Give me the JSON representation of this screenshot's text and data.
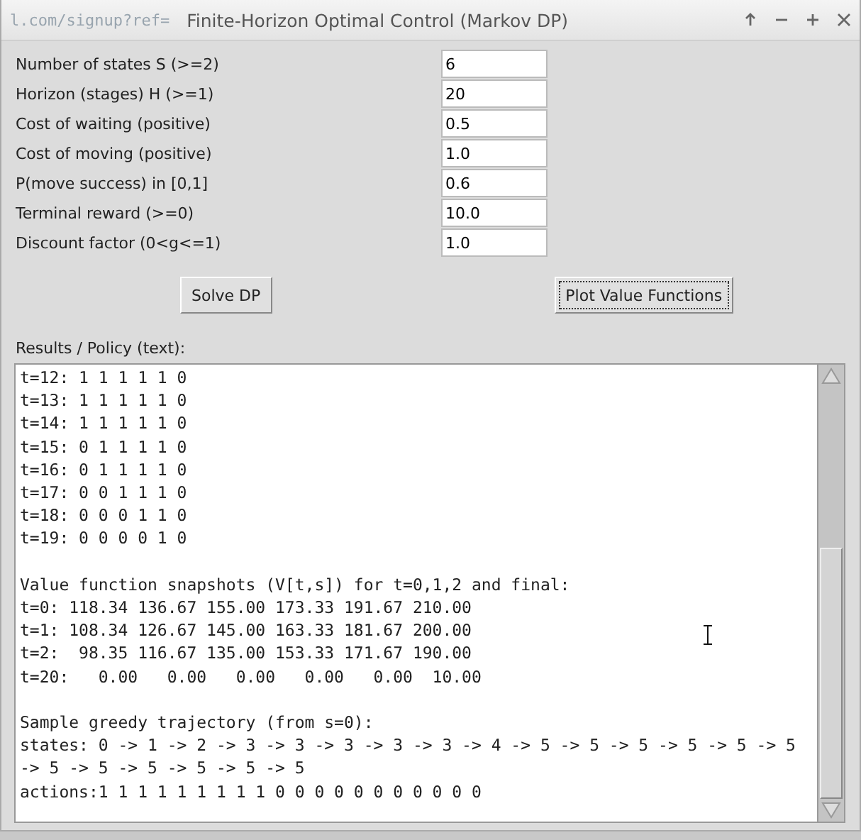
{
  "window": {
    "title": "Finite-Horizon Optimal Control (Markov DP)",
    "background_text": "l.com/signup?ref="
  },
  "fields": [
    {
      "label": "Number of states S (>=2)",
      "value": "6"
    },
    {
      "label": "Horizon (stages) H (>=1)",
      "value": "20"
    },
    {
      "label": "Cost of waiting (positive)",
      "value": "0.5"
    },
    {
      "label": "Cost of moving (positive)",
      "value": "1.0"
    },
    {
      "label": "P(move success) in [0,1]",
      "value": "0.6"
    },
    {
      "label": "Terminal reward (>=0)",
      "value": "10.0"
    },
    {
      "label": "Discount factor (0<g<=1)",
      "value": "1.0"
    }
  ],
  "buttons": [
    {
      "label": "Solve DP",
      "focused": false
    },
    {
      "label": "Plot Value Functions",
      "focused": true
    }
  ],
  "results": {
    "label": "Results / Policy (text):",
    "sections": [
      [
        "t=12: 1 1 1 1 1 0",
        "t=13: 1 1 1 1 1 0",
        "t=14: 1 1 1 1 1 0",
        "t=15: 0 1 1 1 1 0",
        "t=16: 0 1 1 1 1 0",
        "t=17: 0 0 1 1 1 0",
        "t=18: 0 0 0 1 1 0",
        "t=19: 0 0 0 0 1 0"
      ],
      [
        "Value function snapshots (V[t,s]) for t=0,1,2 and final:",
        "t=0: 118.34 136.67 155.00 173.33 191.67 210.00",
        "t=1: 108.34 126.67 145.00 163.33 181.67 200.00",
        "t=2:  98.35 116.67 135.00 153.33 171.67 190.00",
        "t=20:   0.00   0.00   0.00   0.00   0.00  10.00"
      ],
      [
        "Sample greedy trajectory (from s=0):",
        "states: 0 -> 1 -> 2 -> 3 -> 3 -> 3 -> 3 -> 3 -> 4 -> 5 -> 5 -> 5 -> 5 -> 5 -> 5",
        "-> 5 -> 5 -> 5 -> 5 -> 5 -> 5",
        "actions:1 1 1 1 1 1 1 1 1 0 0 0 0 0 0 0 0 0 0 0"
      ]
    ]
  }
}
